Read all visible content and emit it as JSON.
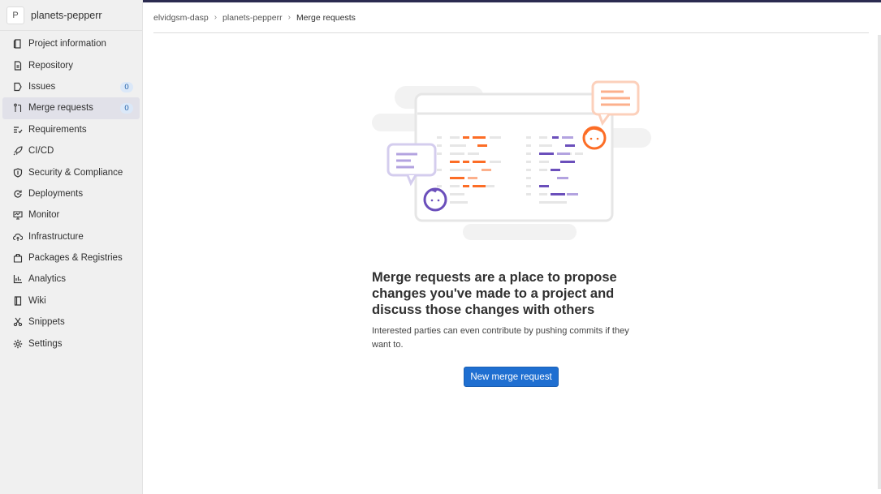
{
  "project": {
    "avatar_letter": "P",
    "name": "planets-pepperr"
  },
  "sidebar": {
    "items": [
      {
        "label": "Project information",
        "icon": "project-info-icon"
      },
      {
        "label": "Repository",
        "icon": "repository-icon"
      },
      {
        "label": "Issues",
        "icon": "issues-icon",
        "count": "0"
      },
      {
        "label": "Merge requests",
        "icon": "merge-request-icon",
        "count": "0",
        "active": true
      },
      {
        "label": "Requirements",
        "icon": "requirements-icon"
      },
      {
        "label": "CI/CD",
        "icon": "rocket-icon"
      },
      {
        "label": "Security & Compliance",
        "icon": "shield-icon"
      },
      {
        "label": "Deployments",
        "icon": "deployments-icon"
      },
      {
        "label": "Monitor",
        "icon": "monitor-icon"
      },
      {
        "label": "Infrastructure",
        "icon": "cloud-icon"
      },
      {
        "label": "Packages & Registries",
        "icon": "package-icon"
      },
      {
        "label": "Analytics",
        "icon": "chart-icon"
      },
      {
        "label": "Wiki",
        "icon": "book-icon"
      },
      {
        "label": "Snippets",
        "icon": "scissors-icon"
      },
      {
        "label": "Settings",
        "icon": "gear-icon"
      }
    ]
  },
  "breadcrumb": {
    "items": [
      "elvidgsm-dasp",
      "planets-pepperr",
      "Merge requests"
    ],
    "separator": "›"
  },
  "empty_state": {
    "title": "Merge requests are a place to propose changes you've made to a project and discuss those changes with others",
    "description": "Interested parties can even contribute by pushing commits if they want to.",
    "button_label": "New merge request"
  },
  "colors": {
    "accent": "#1f6fd1",
    "sidebar_bg": "#f0f0f0",
    "active_bg": "#e1e1e9",
    "badge_bg": "#dbe8f8",
    "illustration_orange": "#fc6d26",
    "illustration_purple": "#6b4fbb"
  }
}
